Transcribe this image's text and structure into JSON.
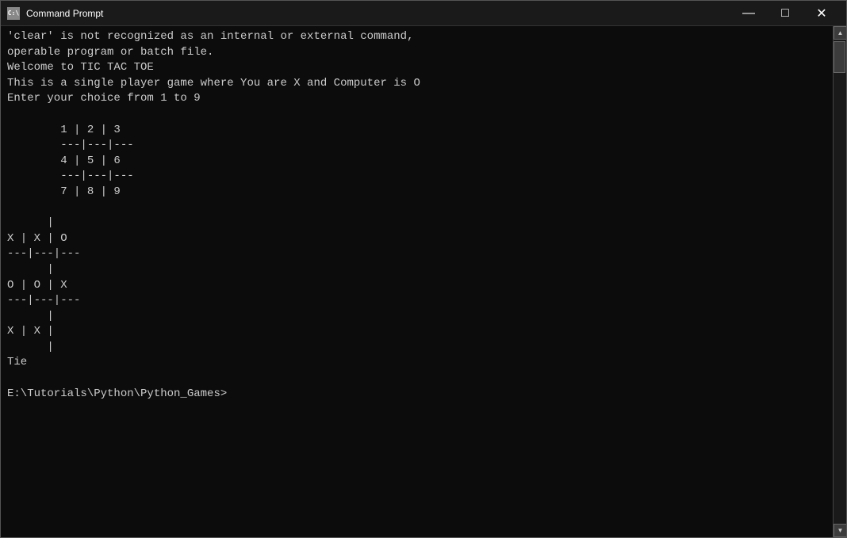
{
  "window": {
    "title": "Command Prompt",
    "icon_label": "C:\\",
    "minimize_label": "—",
    "maximize_label": "□",
    "close_label": "✕"
  },
  "terminal": {
    "content": "'clear' is not recognized as an internal or external command,\noperable program or batch file.\nWelcome to TIC TAC TOE\nThis is a single player game where You are X and Computer is O\nEnter your choice from 1 to 9\n\n        1 | 2 | 3\n        ---|---|---\n        4 | 5 | 6\n        ---|---|---\n        7 | 8 | 9\n\n      |  \nX | X | O\n---|---|---\n      |  \nO | O | X\n---|---|---\n      |  \nX | X |  \n      |  \nTie\n\nE:\\Tutorials\\Python\\Python_Games>"
  }
}
